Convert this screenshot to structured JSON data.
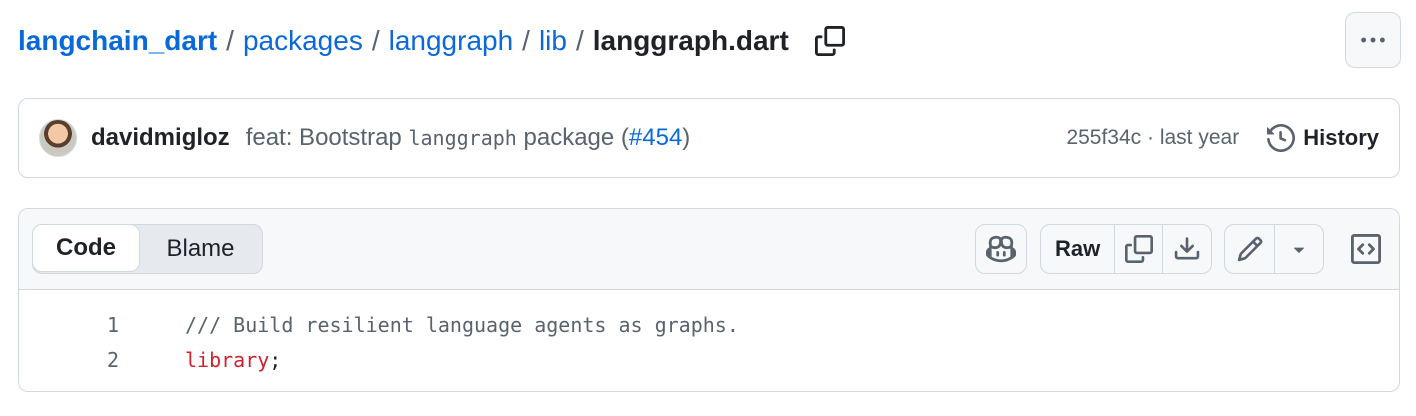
{
  "breadcrumb": {
    "root": "langchain_dart",
    "segments": [
      "packages",
      "langgraph",
      "lib"
    ],
    "file": "langgraph.dart",
    "separator": "/"
  },
  "commit": {
    "author": "davidmigloz",
    "message_prefix": "feat: Bootstrap ",
    "message_code": "langgraph",
    "message_suffix": " package (",
    "pr_link": "#454",
    "message_end": ")",
    "meta": "255f34c · last year",
    "history_label": "History"
  },
  "file_toolbar": {
    "tabs": [
      "Code",
      "Blame"
    ],
    "raw_label": "Raw"
  },
  "code": {
    "lines": [
      {
        "number": "1",
        "text": "/// Build resilient language agents as graphs."
      },
      {
        "number": "2",
        "keyword": "library",
        "rest": ";"
      }
    ]
  },
  "colors": {
    "link": "#0969da",
    "keyword": "#cf222e",
    "muted": "#59636e",
    "border": "#d1d9e0"
  },
  "icons": [
    "copy-icon",
    "kebab-icon",
    "history-icon",
    "copilot-icon",
    "download-icon",
    "pencil-icon",
    "triangle-down-icon",
    "code-square-icon"
  ]
}
